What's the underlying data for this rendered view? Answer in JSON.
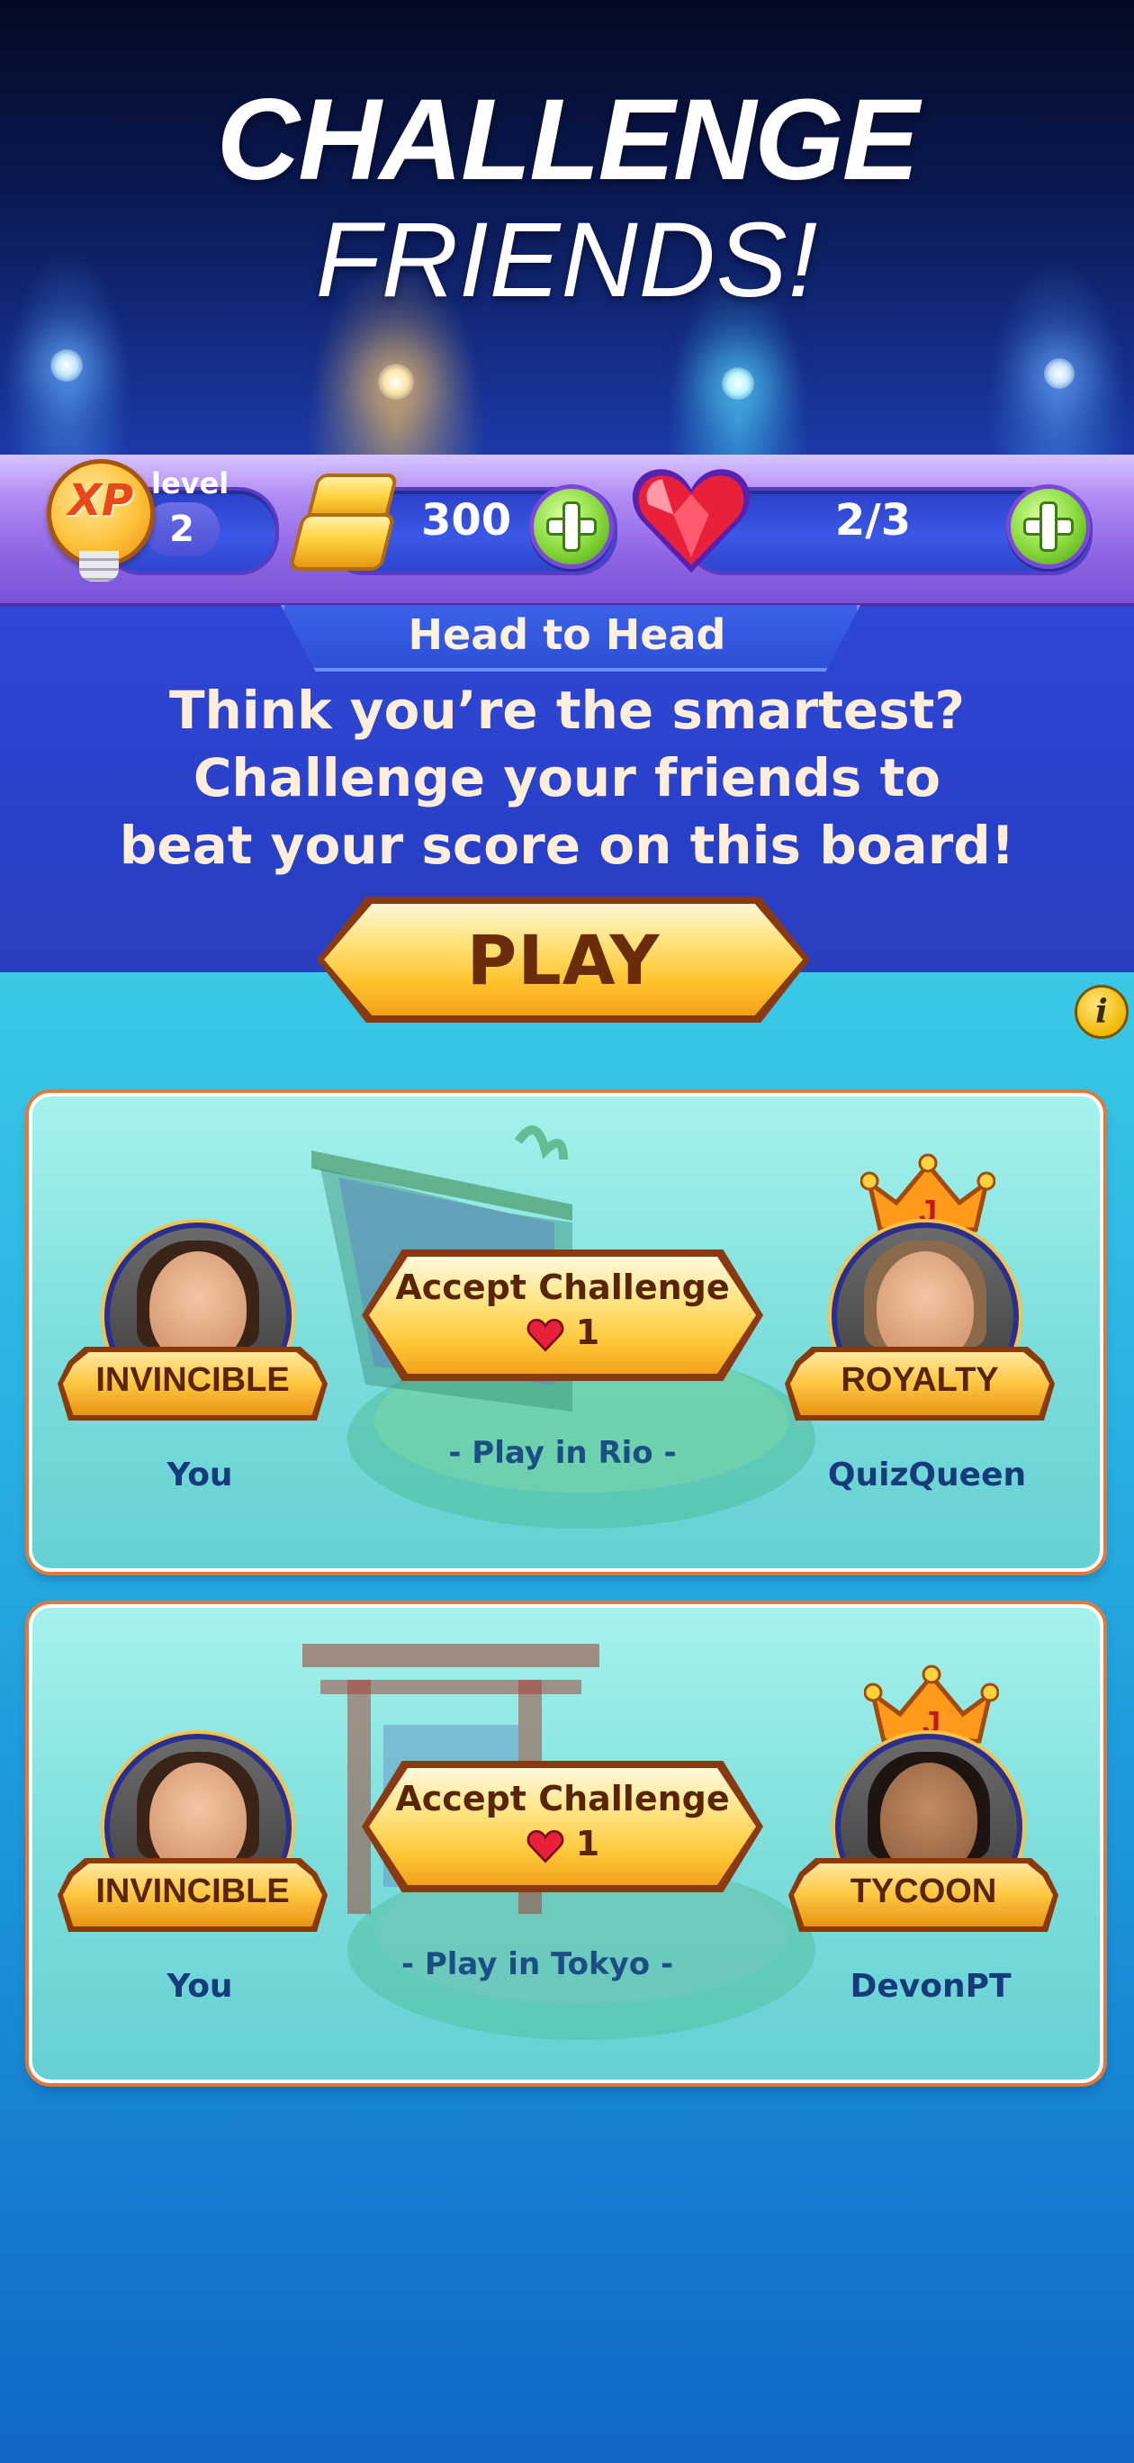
{
  "hero": {
    "title_line1": "CHALLENGE",
    "title_line2": "FRIENDS!"
  },
  "resources": {
    "level_label": "level",
    "level_value": "2",
    "xp_badge": "XP",
    "gold_count": "300",
    "lives": "2/3"
  },
  "banner": {
    "tab_label": "Head to Head",
    "tagline": [
      "Think you’re the smartest?",
      "Challenge your friends to",
      "beat your score on this board!"
    ]
  },
  "play_button": {
    "label": "PLAY"
  },
  "info_button": {
    "label": "i"
  },
  "challenges": [
    {
      "left_player": {
        "name": "You",
        "rank": "INVINCIBLE"
      },
      "right_player": {
        "name": "QuizQueen",
        "rank": "ROYALTY",
        "crown_letter": "J"
      },
      "accept_label": "Accept Challenge",
      "cost": "1",
      "location": "- Play in Rio -"
    },
    {
      "left_player": {
        "name": "You",
        "rank": "INVINCIBLE"
      },
      "right_player": {
        "name": "DevonPT",
        "rank": "TYCOON",
        "crown_letter": "J"
      },
      "accept_label": "Accept Challenge",
      "cost": "1",
      "location": "- Play in Tokyo -"
    }
  ],
  "colors": {
    "accent_gold": "#ffc640",
    "banner_blue": "#2f47d6",
    "card_teal": "#7edfdc",
    "heart_red": "#e8203a"
  }
}
